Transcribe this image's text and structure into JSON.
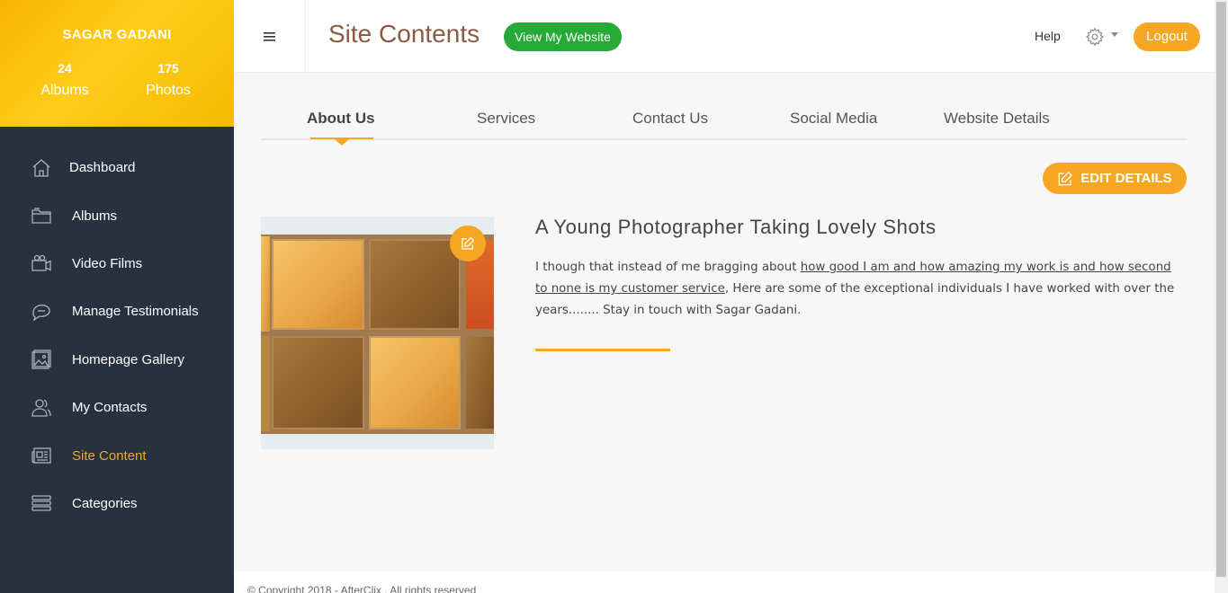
{
  "profile": {
    "name": "SAGAR GADANI",
    "albums_count": "24",
    "albums_label": "Albums",
    "photos_count": "175",
    "photos_label": "Photos"
  },
  "sidebar": {
    "items": [
      {
        "label": "Dashboard",
        "icon": "home-icon"
      },
      {
        "label": "Albums",
        "icon": "folder-icon"
      },
      {
        "label": "Video Films",
        "icon": "video-camera-icon"
      },
      {
        "label": "Manage Testimonials",
        "icon": "chat-bubble-icon"
      },
      {
        "label": "Homepage Gallery",
        "icon": "image-icon"
      },
      {
        "label": "My Contacts",
        "icon": "users-icon"
      },
      {
        "label": "Site Content",
        "icon": "newspaper-icon",
        "active": true
      },
      {
        "label": "Categories",
        "icon": "list-icon"
      }
    ]
  },
  "header": {
    "title": "Site Contents",
    "view_site_label": "View My Website",
    "help_label": "Help",
    "logout_label": "Logout"
  },
  "tabs": [
    {
      "label": "About Us",
      "active": true
    },
    {
      "label": "Services"
    },
    {
      "label": "Contact Us"
    },
    {
      "label": "Social Media"
    },
    {
      "label": "Website Details"
    }
  ],
  "edit_details_label": "EDIT DETAILS",
  "about": {
    "heading": "A Young Photographer Taking Lovely Shots",
    "text_part1": "I though that instead of me bragging about ",
    "text_link": "how good I am and how amazing my work is and how second to none is my customer service",
    "text_part2": ", Here are some of the exceptional individuals I have worked with over the years........ Stay in touch with Sagar Gadani."
  },
  "footer": {
    "copyright": "© Copyright 2018 - AfterClix . All rights reserved"
  },
  "colors": {
    "accent": "#f5a623",
    "sidebar_bg": "#27323e",
    "green": "#27a937",
    "title": "#8a5a44"
  }
}
